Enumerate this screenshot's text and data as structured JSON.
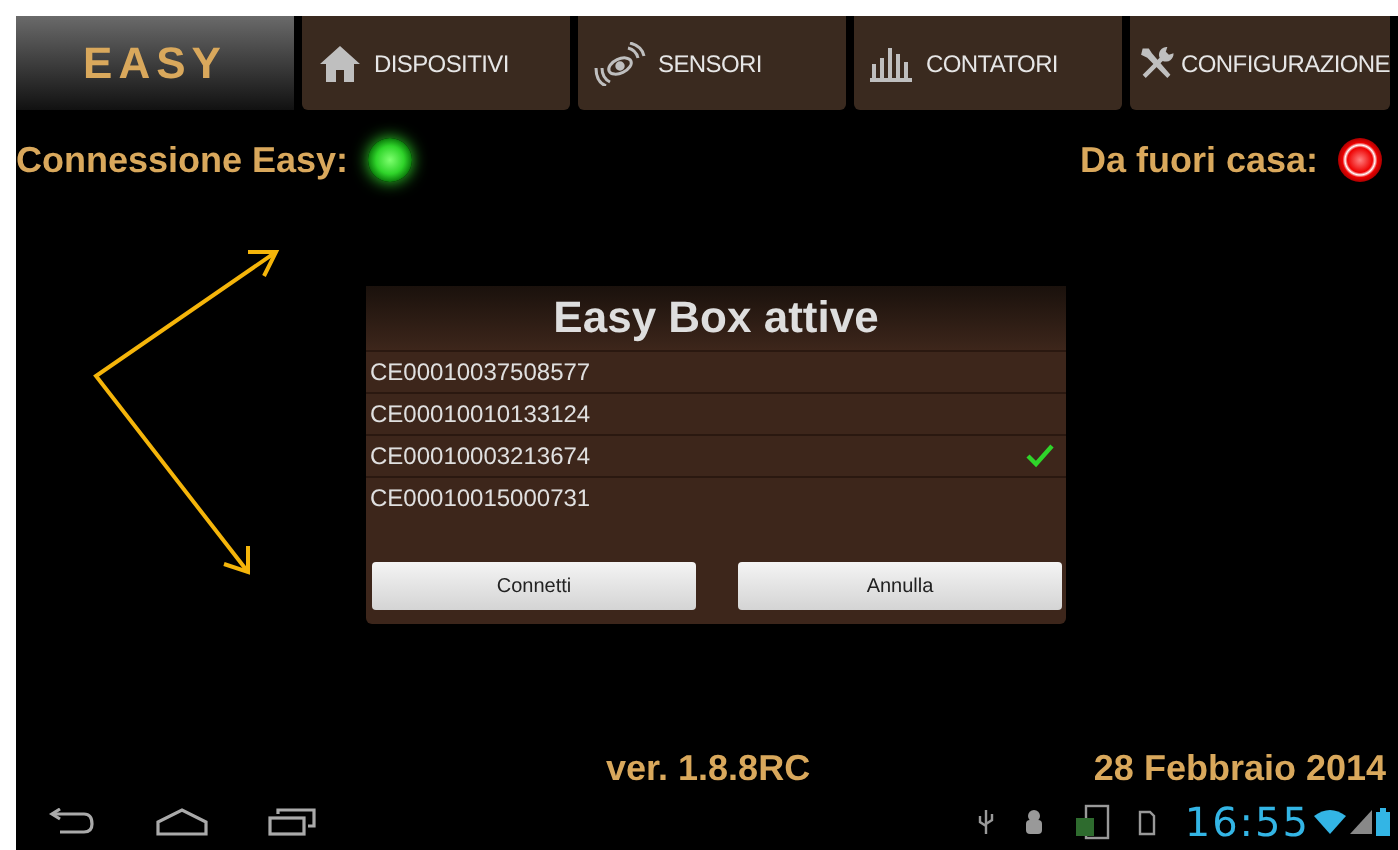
{
  "logo": {
    "text": "EASY",
    "selected": true
  },
  "tabs": [
    {
      "label": "DISPOSITIVI",
      "kind": "house",
      "selected": false
    },
    {
      "label": "SENSORI",
      "kind": "sensor",
      "selected": false
    },
    {
      "label": "CONTATORI",
      "kind": "bars",
      "selected": false
    },
    {
      "label": "CONFIGURAZIONE",
      "kind": "tools",
      "selected": false
    }
  ],
  "indicators": [
    {
      "label": "Connessione Easy:",
      "on": true
    },
    {
      "label": "Da fuori casa:",
      "on": false
    }
  ],
  "dialog": {
    "title": "Easy Box attive",
    "boxes": [
      {
        "id": "CE00010037508577",
        "selected": false
      },
      {
        "id": "CE00010010133124",
        "selected": false
      },
      {
        "id": "CE00010003213674",
        "selected": true
      },
      {
        "id": "CE00010015000731",
        "selected": false
      }
    ],
    "buttons": [
      "Connetti",
      "Annulla"
    ]
  },
  "version": "ver. 1.8.8RC",
  "date": "28 Febbraio 2014",
  "system_bar": {
    "time": "16:55"
  }
}
